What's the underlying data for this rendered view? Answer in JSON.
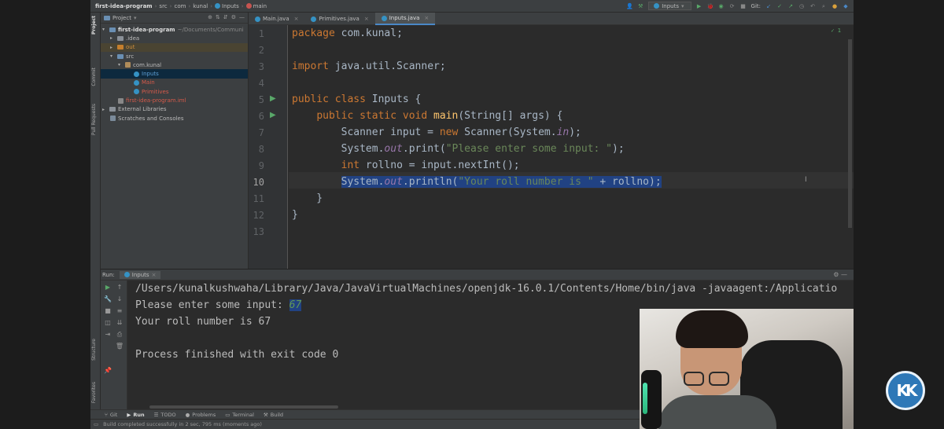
{
  "breadcrumbs": [
    "first-idea-program",
    "src",
    "com",
    "kunal",
    "Inputs",
    "main"
  ],
  "run_config": "Inputs",
  "git_label": "Git:",
  "project_panel": {
    "title": "Project",
    "tree": [
      {
        "label": "first-idea-program",
        "extra": "~/Documents/Communi",
        "level": 0,
        "expanded": true,
        "kind": "folder-blue"
      },
      {
        "label": ".idea",
        "level": 1,
        "expanded": false,
        "kind": "folder"
      },
      {
        "label": "out",
        "level": 1,
        "expanded": false,
        "kind": "folder-orange"
      },
      {
        "label": "src",
        "level": 1,
        "expanded": true,
        "kind": "folder-blue"
      },
      {
        "label": "com.kunal",
        "level": 2,
        "expanded": true,
        "kind": "package"
      },
      {
        "label": "Inputs",
        "level": 3,
        "kind": "class",
        "selected": true
      },
      {
        "label": "Main",
        "level": 3,
        "kind": "class"
      },
      {
        "label": "Primitives",
        "level": 3,
        "kind": "class"
      },
      {
        "label": "first-idea-program.iml",
        "level": 1,
        "kind": "file"
      },
      {
        "label": "External Libraries",
        "level": 0,
        "expanded": false,
        "kind": "lib"
      },
      {
        "label": "Scratches and Consoles",
        "level": 0,
        "kind": "scratch"
      }
    ]
  },
  "editor_tabs": [
    {
      "label": "Main.java",
      "active": false
    },
    {
      "label": "Primitives.java",
      "active": false
    },
    {
      "label": "Inputs.java",
      "active": true
    }
  ],
  "inspection_count": "1",
  "code": {
    "line_numbers": [
      "1",
      "2",
      "3",
      "4",
      "5",
      "6",
      "7",
      "8",
      "9",
      "10",
      "11",
      "12",
      "13"
    ],
    "lines": [
      "package com.kunal;",
      "",
      "import java.util.Scanner;",
      "",
      "public class Inputs {",
      "    public static void main(String[] args) {",
      "        Scanner input = new Scanner(System.in);",
      "        System.out.print(\"Please enter some input: \");",
      "        int rollno = input.nextInt();",
      "        System.out.println(\"Your roll number is \" + rollno);",
      "    }",
      "}",
      ""
    ]
  },
  "run_panel": {
    "label": "Run:",
    "tab": "Inputs",
    "output": {
      "command": "/Users/kunalkushwaha/Library/Java/JavaVirtualMachines/openjdk-16.0.1/Contents/Home/bin/java -javaagent:/Applicatio",
      "prompt": "Please enter some input: ",
      "user_input": "67",
      "result": "Your roll number is 67",
      "exit": "Process finished with exit code 0"
    }
  },
  "side_labels": {
    "project": "Project",
    "commit": "Commit",
    "pull_requests": "Pull Requests",
    "structure": "Structure",
    "favorites": "Favorites"
  },
  "bottom_tabs": [
    "Git",
    "Run",
    "TODO",
    "Problems",
    "Terminal",
    "Build"
  ],
  "status_text": "Build completed successfully in 2 sec, 795 ms (moments ago)",
  "logo_text": "KK",
  "colors": {
    "keyword": "#cc7832",
    "string": "#6a8759",
    "method": "#ffc66d",
    "field": "#9876aa",
    "selection": "#214283",
    "logo": "#2e78b7"
  }
}
